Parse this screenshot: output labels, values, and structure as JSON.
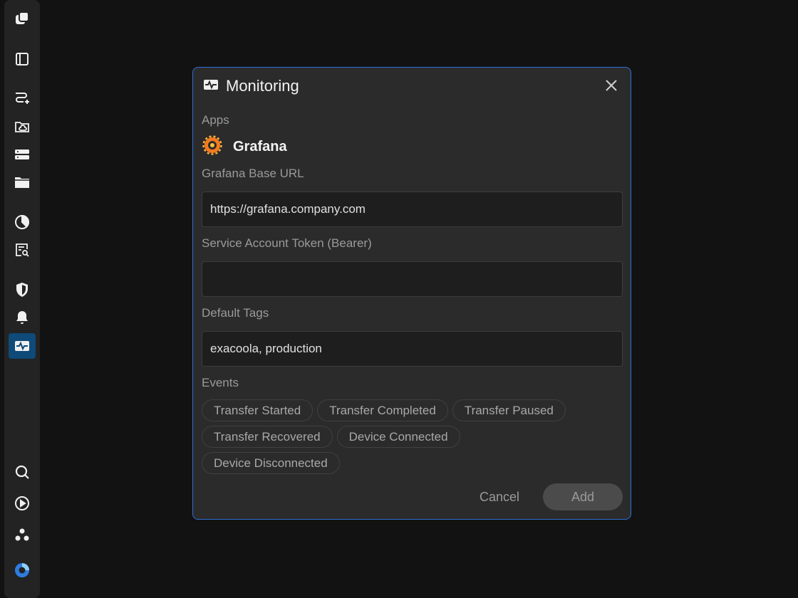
{
  "sidebar": {
    "icons": [
      "app-logo-icon",
      "panel-icon",
      "route-add-icon",
      "cloud-folder-icon",
      "storage-icon",
      "folder-icon",
      "pie-chart-icon",
      "search-document-icon",
      "shield-icon",
      "bell-icon",
      "monitoring-icon",
      "search-icon",
      "play-circle-icon",
      "cluster-icon",
      "brand-icon"
    ],
    "active": "monitoring-icon"
  },
  "dialog": {
    "title": "Monitoring",
    "apps_label": "Apps",
    "app_name": "Grafana",
    "base_url_label": "Grafana Base URL",
    "base_url_value": "https://grafana.company.com",
    "token_label": "Service Account Token (Bearer)",
    "token_value": "",
    "tags_label": "Default Tags",
    "tags_value": "exacoola, production",
    "events_label": "Events",
    "events": [
      "Transfer Started",
      "Transfer Completed",
      "Transfer Paused",
      "Transfer Recovered",
      "Device Connected",
      "Device Disconnected"
    ],
    "cancel_label": "Cancel",
    "add_label": "Add"
  },
  "colors": {
    "accent_border": "#2f6fd6",
    "active_sidebar": "#0f4a78",
    "grafana_orange": "#f47a20"
  }
}
